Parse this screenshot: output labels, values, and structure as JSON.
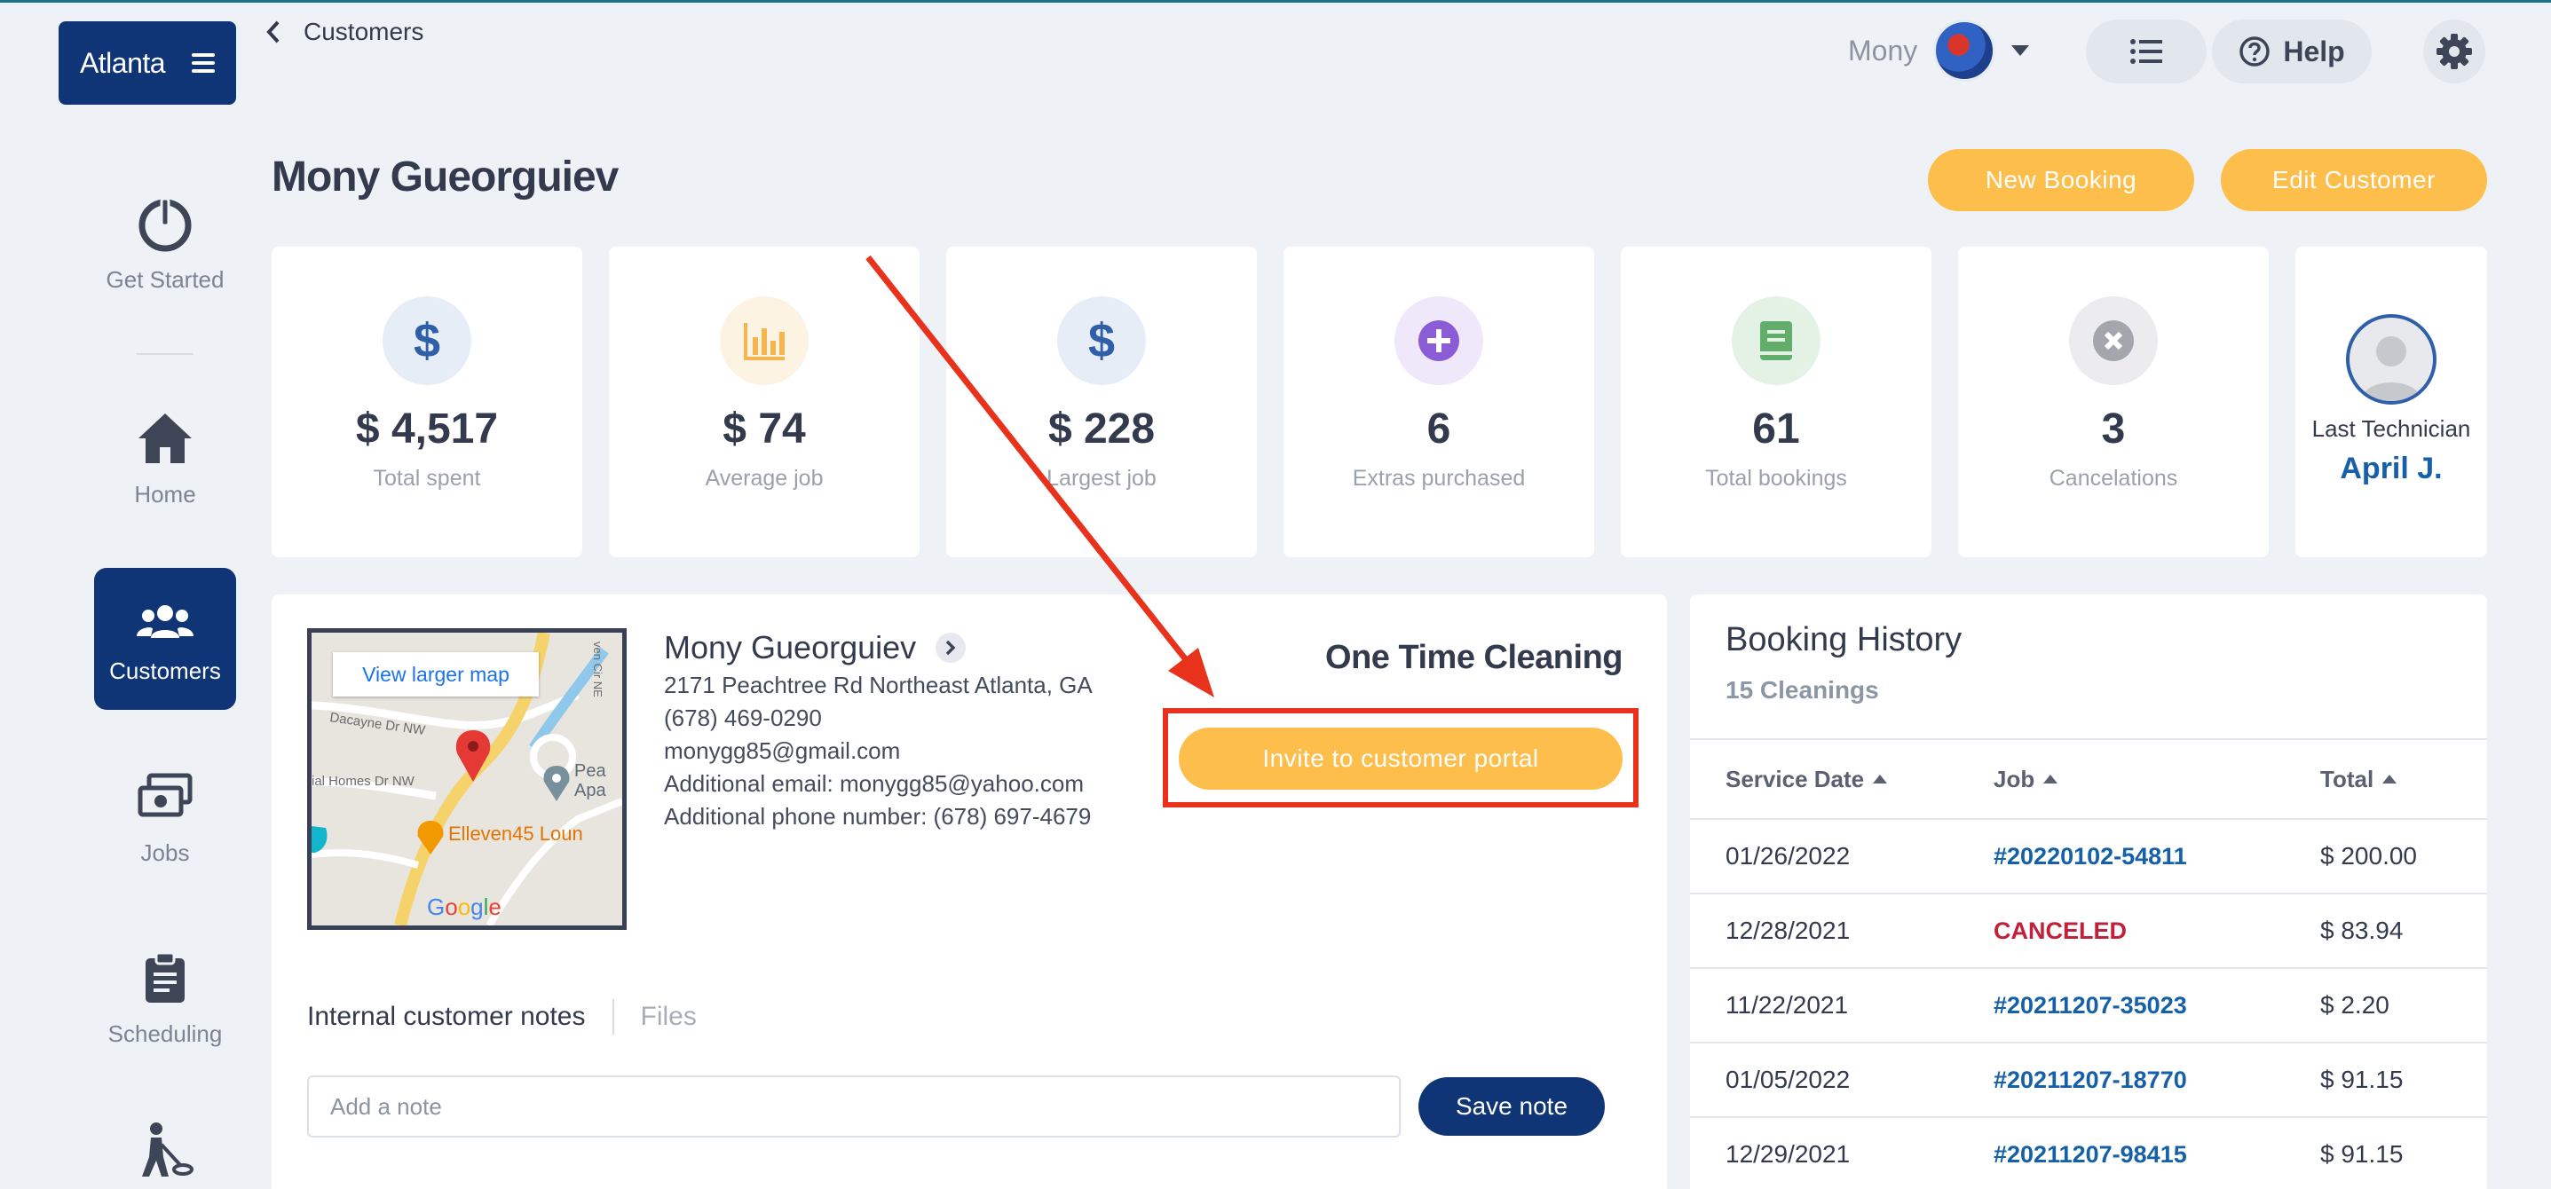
{
  "brand": {
    "name": "Atlanta"
  },
  "sidebar": {
    "items": [
      {
        "label": "Get Started"
      },
      {
        "label": "Home"
      },
      {
        "label": "Customers"
      },
      {
        "label": "Jobs"
      },
      {
        "label": "Scheduling"
      }
    ]
  },
  "topbar": {
    "breadcrumb": "Customers",
    "user_name": "Mony",
    "help_label": "Help"
  },
  "header": {
    "customer_name": "Mony Gueorguiev",
    "new_booking": "New Booking",
    "edit_customer": "Edit Customer"
  },
  "stats": [
    {
      "value": "$ 4,517",
      "label": "Total spent",
      "icon": "dollar-icon",
      "color": "#2f5fa8"
    },
    {
      "value": "$ 74",
      "label": "Average job",
      "icon": "bar-chart-icon",
      "color": "#f5b650"
    },
    {
      "value": "$ 228",
      "label": "Largest job",
      "icon": "dollar-icon",
      "color": "#2f5fa8"
    },
    {
      "value": "6",
      "label": "Extras purchased",
      "icon": "plus-icon",
      "color": "#8a5cd6"
    },
    {
      "value": "61",
      "label": "Total bookings",
      "icon": "book-icon",
      "color": "#63ad6a"
    },
    {
      "value": "3",
      "label": "Cancelations",
      "icon": "x-circle-icon",
      "color": "#a3a7ad"
    }
  ],
  "last_technician": {
    "label": "Last Technician",
    "name": "April J."
  },
  "customer": {
    "name": "Mony Gueorguiev",
    "address": "2171 Peachtree Rd Northeast Atlanta, GA",
    "phone": "(678) 469-0290",
    "email": "monygg85@gmail.com",
    "additional_email": "Additional email: monygg85@yahoo.com",
    "additional_phone": "Additional phone number: (678) 697-4679",
    "service": "One Time Cleaning",
    "invite_label": "Invite to customer portal"
  },
  "map": {
    "view_larger": "View larger map",
    "labels": [
      "Dacayne Dr NW",
      "ial Homes Dr NW",
      "Pea",
      "Apa",
      "Elleven45 Loun",
      "ven Cir NE",
      "Google"
    ]
  },
  "notes": {
    "tab_notes": "Internal customer notes",
    "tab_files": "Files",
    "placeholder": "Add a note",
    "save_label": "Save note"
  },
  "booking_history": {
    "title": "Booking History",
    "subtitle": "15 Cleanings",
    "columns": [
      "Service Date",
      "Job",
      "Total"
    ],
    "rows": [
      {
        "date": "01/26/2022",
        "job": "#20220102-54811",
        "total": "$ 200.00"
      },
      {
        "date": "12/28/2021",
        "job": "CANCELED",
        "total": "$ 83.94"
      },
      {
        "date": "11/22/2021",
        "job": "#20211207-35023",
        "total": "$ 2.20"
      },
      {
        "date": "01/05/2022",
        "job": "#20211207-18770",
        "total": "$ 91.15"
      },
      {
        "date": "12/29/2021",
        "job": "#20211207-98415",
        "total": "$ 91.15"
      }
    ]
  },
  "colors": {
    "navy": "#0f3576",
    "orange": "#fdbe4c",
    "annotation_red": "#e8321c",
    "link_blue": "#1560a8",
    "canceled_red": "#c0203a"
  }
}
